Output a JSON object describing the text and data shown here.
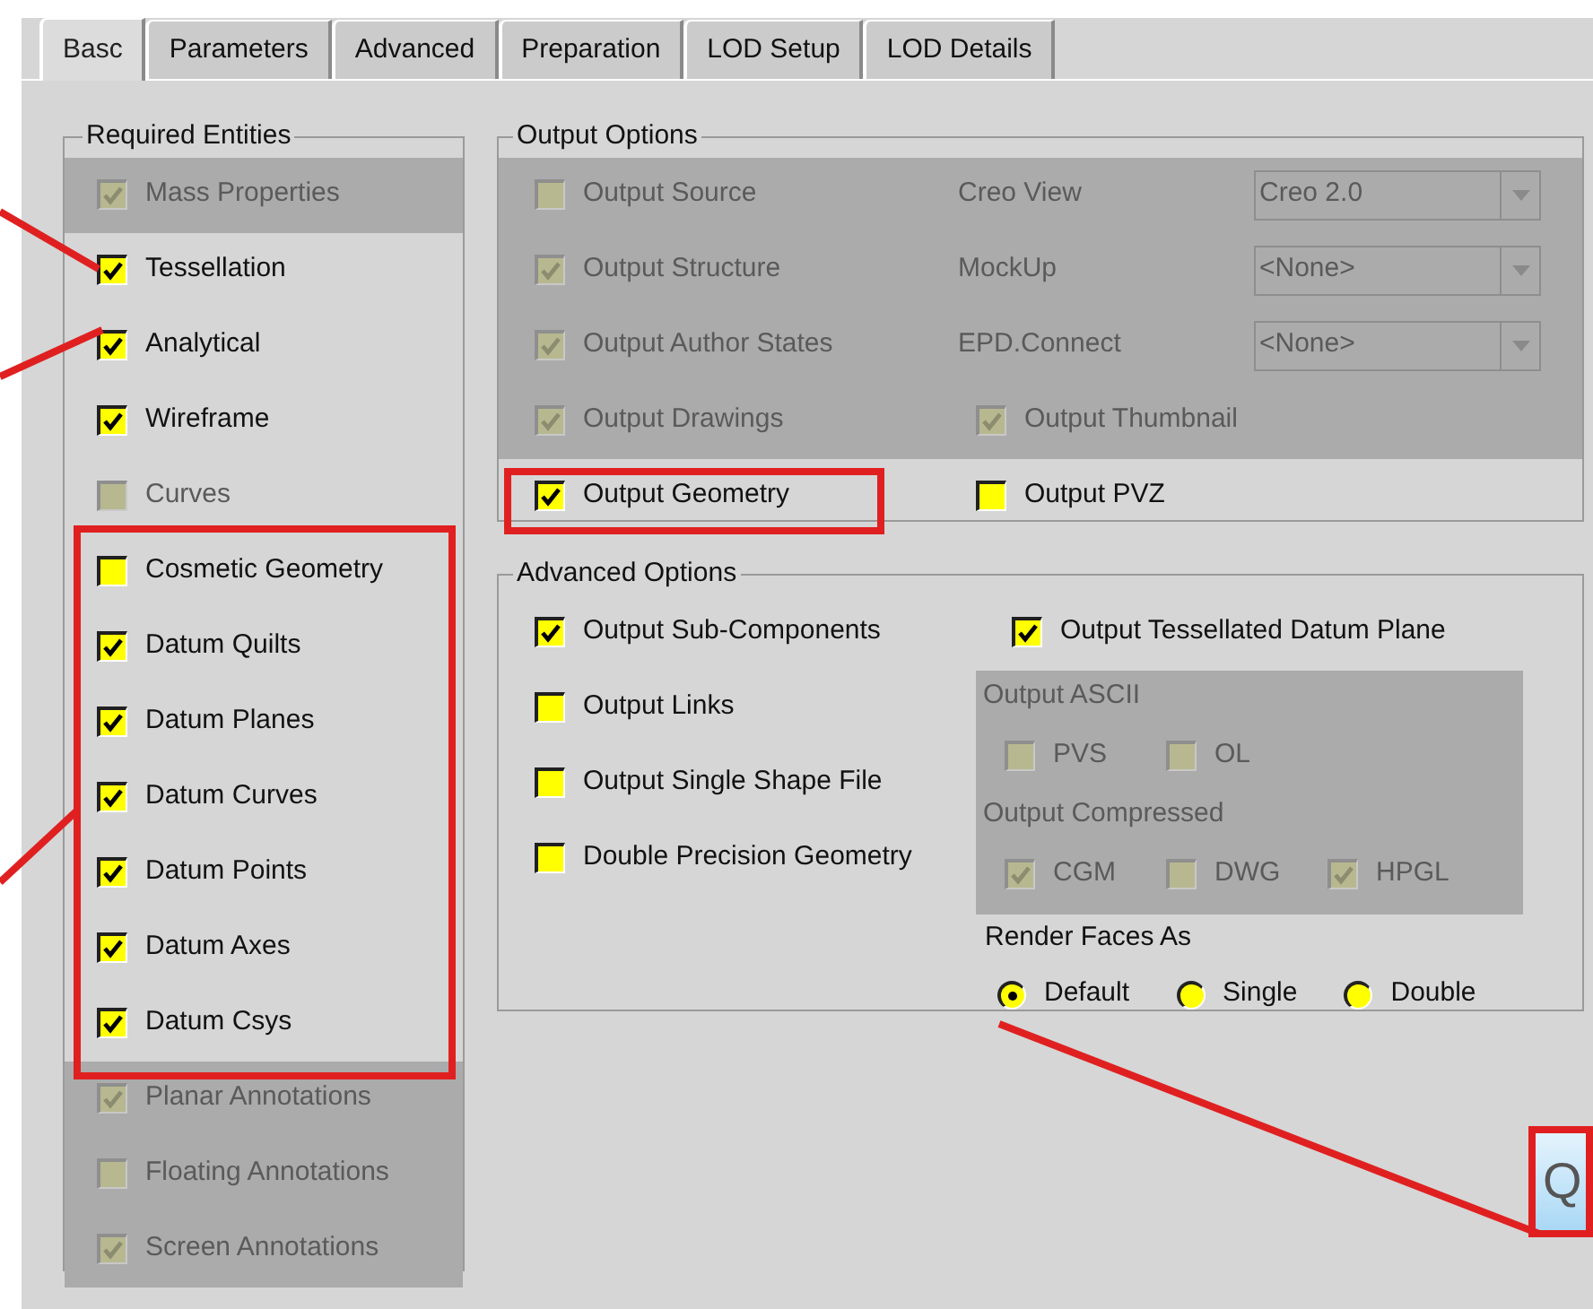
{
  "tabs": [
    {
      "label": "Basc",
      "selected": true
    },
    {
      "label": "Parameters",
      "selected": false
    },
    {
      "label": "Advanced",
      "selected": false
    },
    {
      "label": "Preparation",
      "selected": false
    },
    {
      "label": "LOD Setup",
      "selected": false
    },
    {
      "label": "LOD Details",
      "selected": false
    }
  ],
  "required_entities": {
    "title": "Required Entities",
    "items": [
      {
        "label": "Mass Properties",
        "checked": true,
        "disabled": true,
        "highlighted": true
      },
      {
        "label": "Tessellation",
        "checked": true,
        "disabled": false,
        "highlighted": false
      },
      {
        "label": "Analytical",
        "checked": true,
        "disabled": false,
        "highlighted": false
      },
      {
        "label": "Wireframe",
        "checked": true,
        "disabled": false,
        "highlighted": false
      },
      {
        "label": "Curves",
        "checked": false,
        "disabled": true,
        "highlighted": false
      },
      {
        "label": "Cosmetic Geometry",
        "checked": false,
        "disabled": false,
        "highlighted": false
      },
      {
        "label": "Datum Quilts",
        "checked": true,
        "disabled": false,
        "highlighted": false
      },
      {
        "label": "Datum Planes",
        "checked": true,
        "disabled": false,
        "highlighted": false
      },
      {
        "label": "Datum Curves",
        "checked": true,
        "disabled": false,
        "highlighted": false
      },
      {
        "label": "Datum Points",
        "checked": true,
        "disabled": false,
        "highlighted": false
      },
      {
        "label": "Datum Axes",
        "checked": true,
        "disabled": false,
        "highlighted": false
      },
      {
        "label": "Datum Csys",
        "checked": true,
        "disabled": false,
        "highlighted": false
      },
      {
        "label": "Planar Annotations",
        "checked": true,
        "disabled": true,
        "highlighted": true
      },
      {
        "label": "Floating Annotations",
        "checked": false,
        "disabled": true,
        "highlighted": true
      },
      {
        "label": "Screen Annotations",
        "checked": true,
        "disabled": true,
        "highlighted": true
      }
    ]
  },
  "output_options": {
    "title": "Output Options",
    "rows": [
      {
        "highlighted": true,
        "left": {
          "label": "Output Source",
          "checked": false,
          "disabled": true
        },
        "right": {
          "kind": "combo",
          "label": "Creo View",
          "value": "Creo 2.0",
          "disabled": true
        }
      },
      {
        "highlighted": true,
        "left": {
          "label": "Output Structure",
          "checked": true,
          "disabled": true
        },
        "right": {
          "kind": "combo",
          "label": "MockUp",
          "value": "<None>",
          "disabled": true
        }
      },
      {
        "highlighted": true,
        "left": {
          "label": "Output Author States",
          "checked": true,
          "disabled": true
        },
        "right": {
          "kind": "combo",
          "label": "EPD.Connect",
          "value": "<None>",
          "disabled": true
        }
      },
      {
        "highlighted": true,
        "left": {
          "label": "Output Drawings",
          "checked": true,
          "disabled": true
        },
        "right": {
          "kind": "check",
          "label": "Output Thumbnail",
          "checked": true,
          "disabled": true
        }
      },
      {
        "highlighted": false,
        "left": {
          "label": "Output Geometry",
          "checked": true,
          "disabled": false
        },
        "right": {
          "kind": "check",
          "label": "Output PVZ",
          "checked": false,
          "disabled": false
        }
      }
    ]
  },
  "advanced_options": {
    "title": "Advanced Options",
    "left_items": [
      {
        "label": "Output Sub-Components",
        "checked": true,
        "disabled": false
      },
      {
        "label": "Output Links",
        "checked": false,
        "disabled": false
      },
      {
        "label": "Output Single Shape File",
        "checked": false,
        "disabled": false
      },
      {
        "label": "Double Precision Geometry",
        "checked": false,
        "disabled": false
      }
    ],
    "tessellated": {
      "label": "Output Tessellated Datum Plane",
      "checked": true,
      "disabled": false
    },
    "groups": [
      {
        "title": "Output ASCII",
        "items": [
          {
            "label": "PVS",
            "checked": false,
            "disabled": true
          },
          {
            "label": "OL",
            "checked": false,
            "disabled": true
          }
        ]
      },
      {
        "title": "Output Compressed",
        "items": [
          {
            "label": "CGM",
            "checked": true,
            "disabled": true
          },
          {
            "label": "DWG",
            "checked": false,
            "disabled": true
          },
          {
            "label": "HPGL",
            "checked": true,
            "disabled": true
          }
        ]
      }
    ],
    "render_faces": {
      "title": "Render Faces As",
      "options": [
        {
          "label": "Default",
          "selected": true
        },
        {
          "label": "Single",
          "selected": false
        },
        {
          "label": "Double",
          "selected": false
        }
      ]
    }
  },
  "button": {
    "label": "Q"
  }
}
